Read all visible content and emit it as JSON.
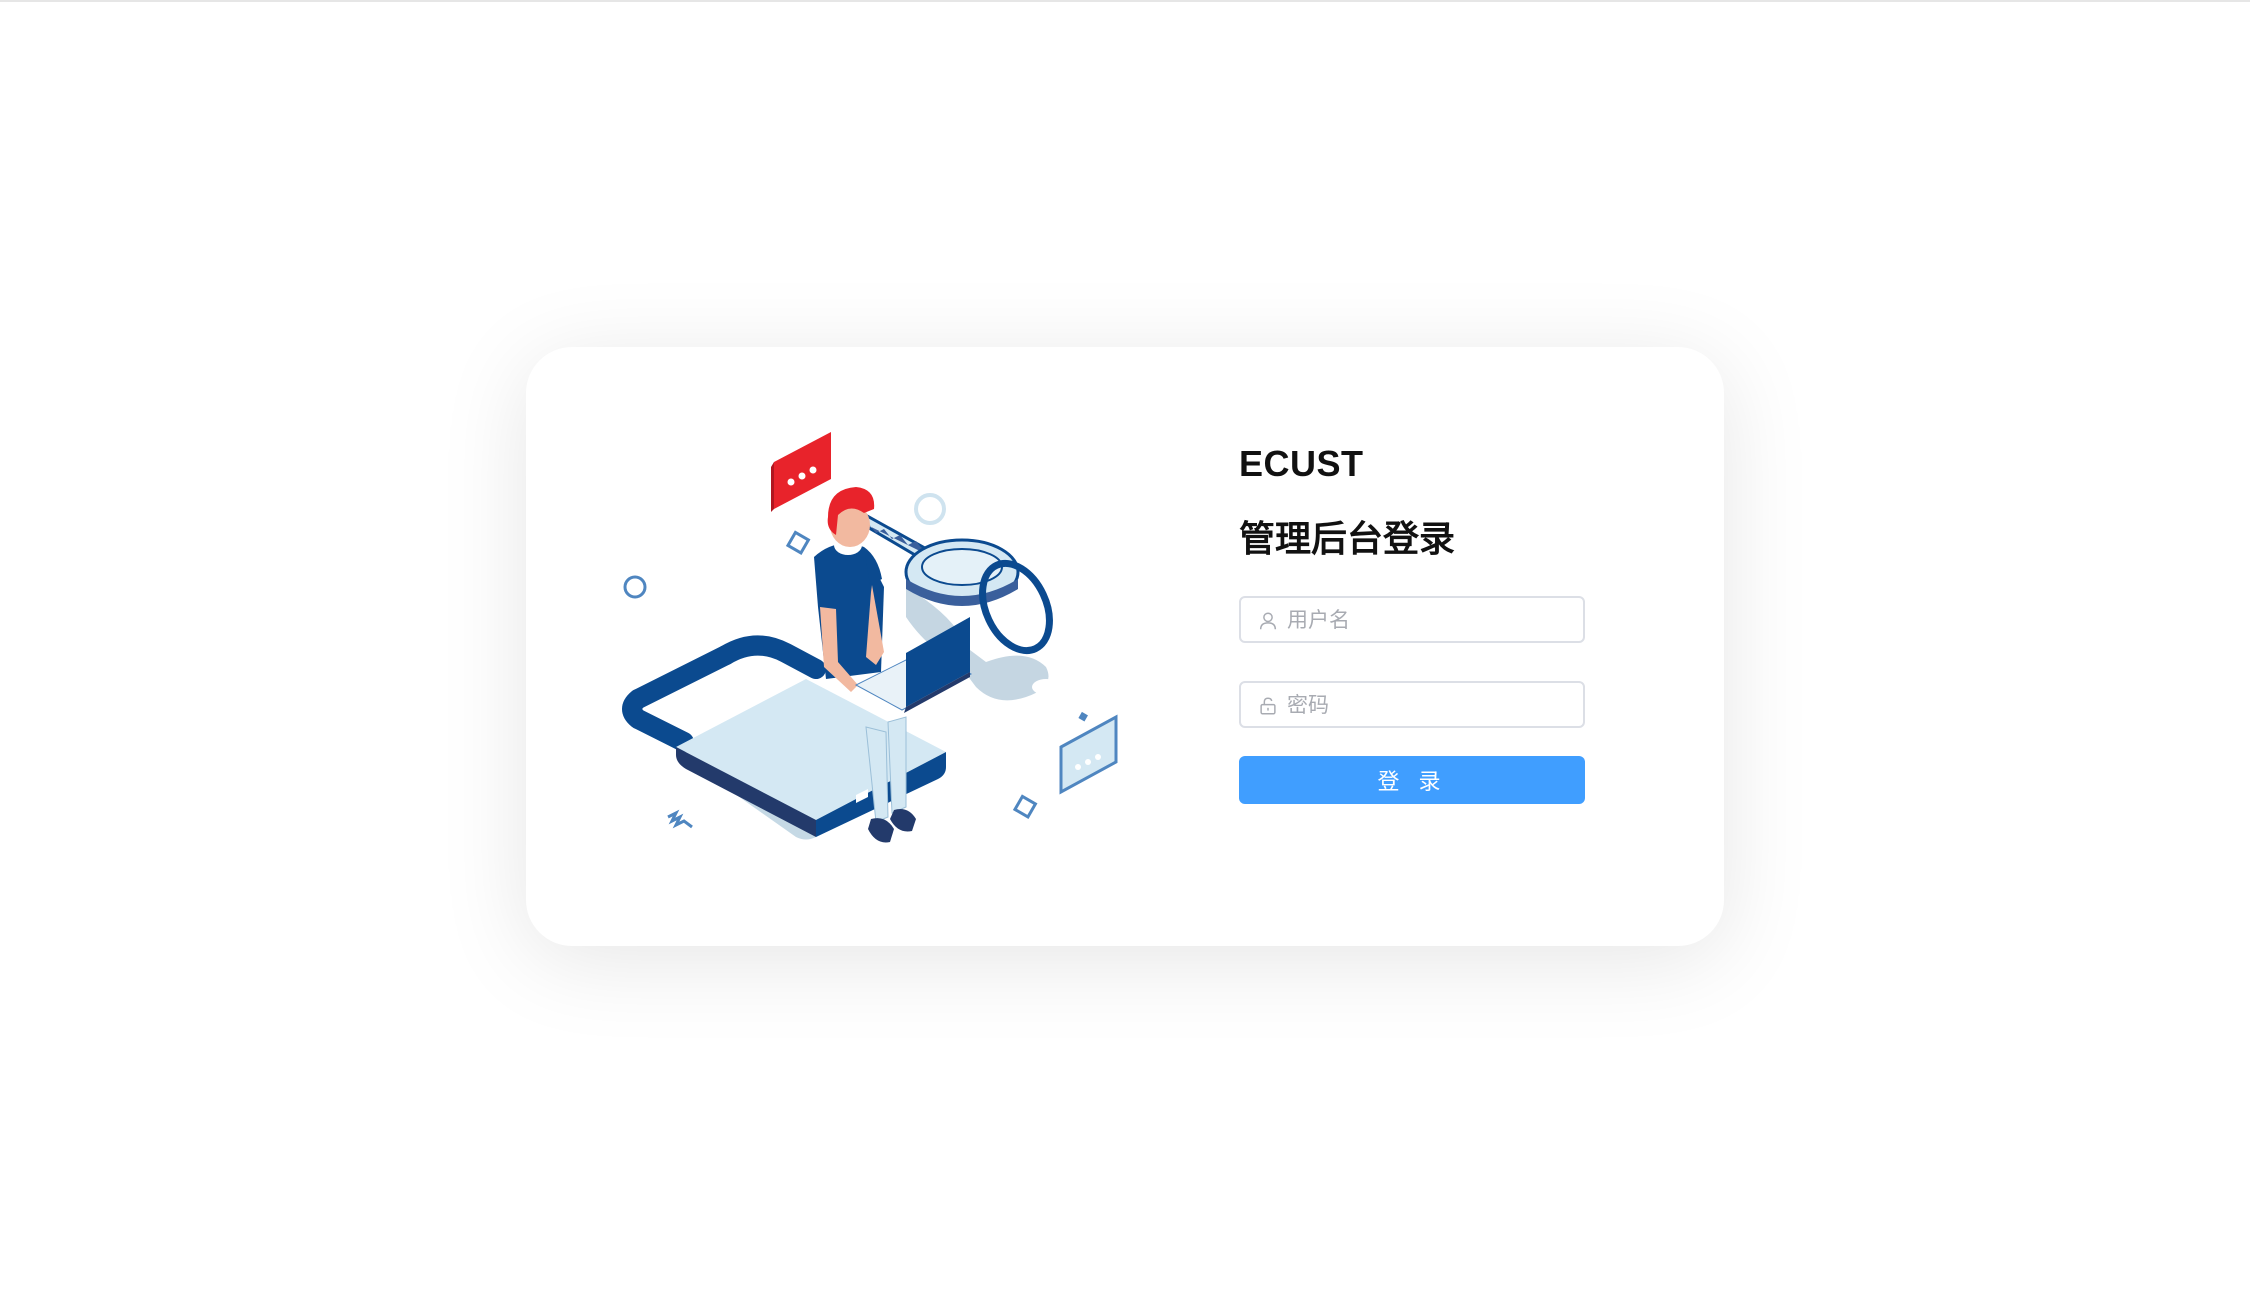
{
  "brand": {
    "name": "ECUST"
  },
  "login": {
    "title": "管理后台登录",
    "username": {
      "placeholder": "用户名",
      "value": "",
      "icon": "user-icon"
    },
    "password": {
      "placeholder": "密码",
      "value": "",
      "icon": "unlock-icon"
    },
    "submit_label": "登 录"
  },
  "colors": {
    "accent": "#409eff",
    "illustration_dark_blue": "#0b4a8f",
    "illustration_light_blue": "#d4e8f3",
    "illustration_red": "#e8232b"
  }
}
